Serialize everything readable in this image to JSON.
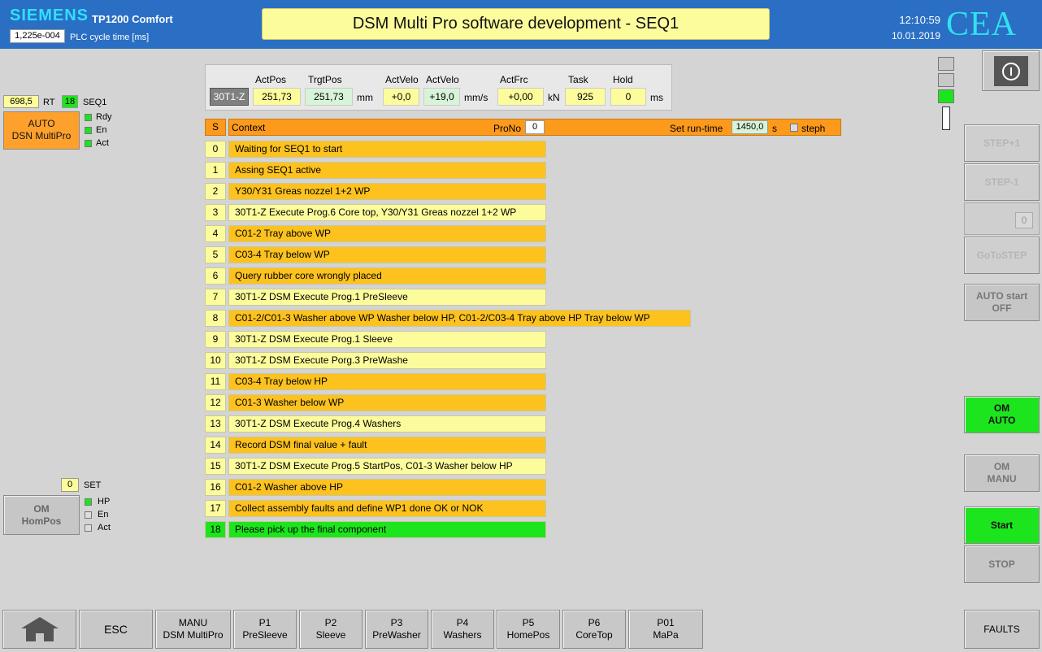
{
  "header": {
    "brand": "SIEMENS",
    "model": "TP1200 Comfort",
    "cycle_value": "1,225e-004",
    "cycle_label": "PLC cycle time [ms]",
    "title": "DSM Multi Pro software development - SEQ1",
    "time": "12:10:59",
    "date": "10.01.2019",
    "logo": "CEA"
  },
  "left": {
    "rt_value": "698,5",
    "rt_label": "RT",
    "seq_value": "18",
    "seq_label": "SEQ1",
    "auto_line1": "AUTO",
    "auto_line2": "DSN MultiPro",
    "status1": [
      "Rdy",
      "En",
      "Act"
    ],
    "set_value": "0",
    "set_label": "SET",
    "om_line1": "OM",
    "om_line2": "HomPos",
    "status2": [
      "HP",
      "En",
      "Act"
    ]
  },
  "axis": {
    "name": "30T1-Z",
    "act_pos_label": "ActPos",
    "act_pos": "251,73",
    "trgt_pos_label": "TrgtPos",
    "trgt_pos": "251,73",
    "pos_unit": "mm",
    "act_velo_label": "ActVelo",
    "act_velo": "+0,0",
    "act_velo2_label": "ActVelo",
    "act_velo2": "+19,0",
    "velo_unit": "mm/s",
    "act_frc_label": "ActFrc",
    "act_frc": "+0,00",
    "frc_unit": "kN",
    "task_label": "Task",
    "task": "925",
    "hold_label": "Hold",
    "hold": "0",
    "hold_unit": "ms"
  },
  "table": {
    "s_header": "S",
    "context_header": "Context",
    "prono_label": "ProNo",
    "prono_value": "0",
    "runtime_label": "Set run-time",
    "runtime_value": "1450,0",
    "runtime_unit": "s",
    "steph_label": "steph",
    "rows": [
      {
        "n": "0",
        "text": "Waiting for SEQ1 to start",
        "style": "orange"
      },
      {
        "n": "1",
        "text": "Assing SEQ1 active",
        "style": "orange"
      },
      {
        "n": "2",
        "text": "Y30/Y31 Greas nozzel 1+2 WP",
        "style": "orange"
      },
      {
        "n": "3",
        "text": "30T1-Z Execute Prog.6 Core top, Y30/Y31 Greas nozzel 1+2 WP",
        "style": "yellow"
      },
      {
        "n": "4",
        "text": "C01-2 Tray above WP",
        "style": "orange"
      },
      {
        "n": "5",
        "text": "C03-4 Tray below WP",
        "style": "orange"
      },
      {
        "n": "6",
        "text": "Query rubber core wrongly placed",
        "style": "orange"
      },
      {
        "n": "7",
        "text": "30T1-Z DSM Execute Prog.1 PreSleeve",
        "style": "yellow"
      },
      {
        "n": "8",
        "text": "C01-2/C01-3 Washer above WP Washer below HP, C01-2/C03-4 Tray above HP Tray below WP",
        "style": "orange"
      },
      {
        "n": "9",
        "text": "30T1-Z DSM Execute Prog.1 Sleeve",
        "style": "yellow"
      },
      {
        "n": "10",
        "text": "30T1-Z DSM Execute Porg.3 PreWashe",
        "style": "yellow"
      },
      {
        "n": "11",
        "text": "C03-4 Tray below HP",
        "style": "orange"
      },
      {
        "n": "12",
        "text": "C01-3 Washer below WP",
        "style": "orange"
      },
      {
        "n": "13",
        "text": "30T1-Z DSM Execute Prog.4 Washers",
        "style": "yellow"
      },
      {
        "n": "14",
        "text": "Record DSM final value + fault",
        "style": "orange"
      },
      {
        "n": "15",
        "text": "30T1-Z DSM Execute Prog.5 StartPos, C01-3 Washer below HP",
        "style": "yellow"
      },
      {
        "n": "16",
        "text": "C01-2 Washer above HP",
        "style": "orange"
      },
      {
        "n": "17",
        "text": "Collect assembly faults and define WP1 done OK or NOK",
        "style": "orange"
      },
      {
        "n": "18",
        "text": "Please pick up the final component",
        "style": "green"
      }
    ]
  },
  "right": {
    "step_plus": "STEP+1",
    "step_minus": "STEP-1",
    "step_value": "0",
    "goto_step": "GoToSTEP",
    "auto_start_1": "AUTO start",
    "auto_start_2": "OFF",
    "om_auto_1": "OM",
    "om_auto_2": "AUTO",
    "om_manu_1": "OM",
    "om_manu_2": "MANU",
    "start": "Start",
    "stop": "STOP"
  },
  "bottom": {
    "esc": "ESC",
    "buttons": [
      {
        "l1": "MANU",
        "l2": "DSM MultiPro"
      },
      {
        "l1": "P1",
        "l2": "PreSleeve"
      },
      {
        "l1": "P2",
        "l2": "Sleeve"
      },
      {
        "l1": "P3",
        "l2": "PreWasher"
      },
      {
        "l1": "P4",
        "l2": "Washers"
      },
      {
        "l1": "P5",
        "l2": "HomePos"
      },
      {
        "l1": "P6",
        "l2": "CoreTop"
      },
      {
        "l1": "P01",
        "l2": "MaPa"
      }
    ],
    "faults": "FAULTS"
  },
  "colors": {
    "header_blue": "#2a6fc4",
    "row_orange": "#fdc21e",
    "row_yellow": "#fcfc9c",
    "row_green": "#1de51d",
    "active_green": "#1de51d",
    "header_orange": "#fd9a1c"
  }
}
